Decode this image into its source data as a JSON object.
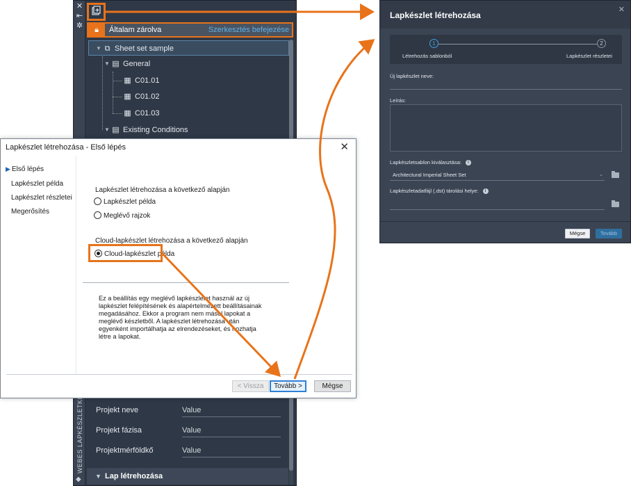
{
  "palette": {
    "strip_buttons": [
      "✕",
      "⇤",
      "✲"
    ],
    "vertical_title": "WEBES LAPKÉSZLETKEZELŐ",
    "lock_label": "Általam zárolva",
    "edit_end_link": "Szerkesztés befejezése",
    "tree": {
      "root": "Sheet set sample",
      "group1": "General",
      "sheets": [
        "C01.01",
        "C01.02",
        "C01.03"
      ],
      "group2": "Existing Conditions"
    },
    "properties": [
      {
        "key": "Projekt neve",
        "value": "Value"
      },
      {
        "key": "Projekt fázisa",
        "value": "Value"
      },
      {
        "key": "Projektmérföldkő",
        "value": "Value"
      }
    ],
    "create_sheet_label": "Lap létrehozása"
  },
  "wizard": {
    "title": "Lapkészlet létrehozása - Első lépés",
    "steps": [
      "Első lépés",
      "Lapkészlet példa",
      "Lapkészlet részletei",
      "Megerősítés"
    ],
    "section1_label": "Lapkészlet létrehozása a következő alapján",
    "option1": "Lapkészlet példa",
    "option2": "Meglévő rajzok",
    "section2_label": "Cloud-lapkészlet létrehozása a következő alapján",
    "option3": "Cloud-lapkészlet példa",
    "description": "Ez a beállítás egy meglévő lapkészletet használ az új lapkészlet felépítésének és alapértelmezett beállításainak megadásához. Ekkor a program nem másol lapokat a meglévő készletből. A lapkészlet létrehozása után egyenként importálhatja az elrendezéseket, és hozhatja létre a lapokat.",
    "back_label": "< Vissza",
    "next_label": "Tovább >",
    "cancel_label": "Mégse"
  },
  "web_dialog": {
    "title": "Lapkészlet létrehozása",
    "step1_num": "1",
    "step1_label": "Létrehozás sablonból",
    "step2_num": "2",
    "step2_label": "Lapkészlet részletei",
    "name_label": "Új lapkészlet neve:",
    "desc_label": "Leírás:",
    "template_label": "Lapkészletsablon kiválasztása:",
    "template_value": "Architectural Imperial Sheet Set",
    "dst_label": "Lapkészletadatfájl (.dst) tárolási helye:",
    "cancel_label": "Mégse",
    "next_label": "Tovább"
  },
  "colors": {
    "accent_orange": "#e8731a",
    "link_blue": "#5fb0e8",
    "dark_panel": "#2f3846",
    "dialog_dark": "#3b4453"
  }
}
